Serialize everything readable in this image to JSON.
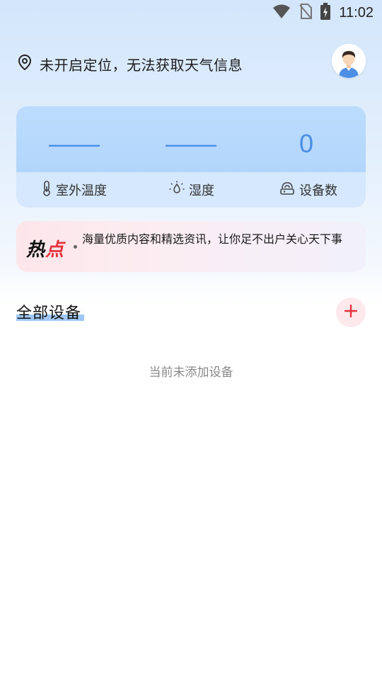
{
  "status_bar": {
    "time": "11:02"
  },
  "location": {
    "text": "未开启定位，无法获取天气信息"
  },
  "weather": {
    "outdoor_temp_value": "——",
    "humidity_value": "——",
    "device_count_value": "0",
    "outdoor_temp_label": "室外温度",
    "humidity_label": "湿度",
    "device_count_label": "设备数"
  },
  "hot_banner": {
    "logo_main": "热",
    "logo_accent": "点",
    "text": "海量优质内容和精选资讯，让你足不出户关心天下事"
  },
  "devices": {
    "title": "全部设备",
    "empty_text": "当前未添加设备"
  },
  "colors": {
    "accent_blue": "#4a8ee6",
    "accent_red": "#e3343c"
  }
}
